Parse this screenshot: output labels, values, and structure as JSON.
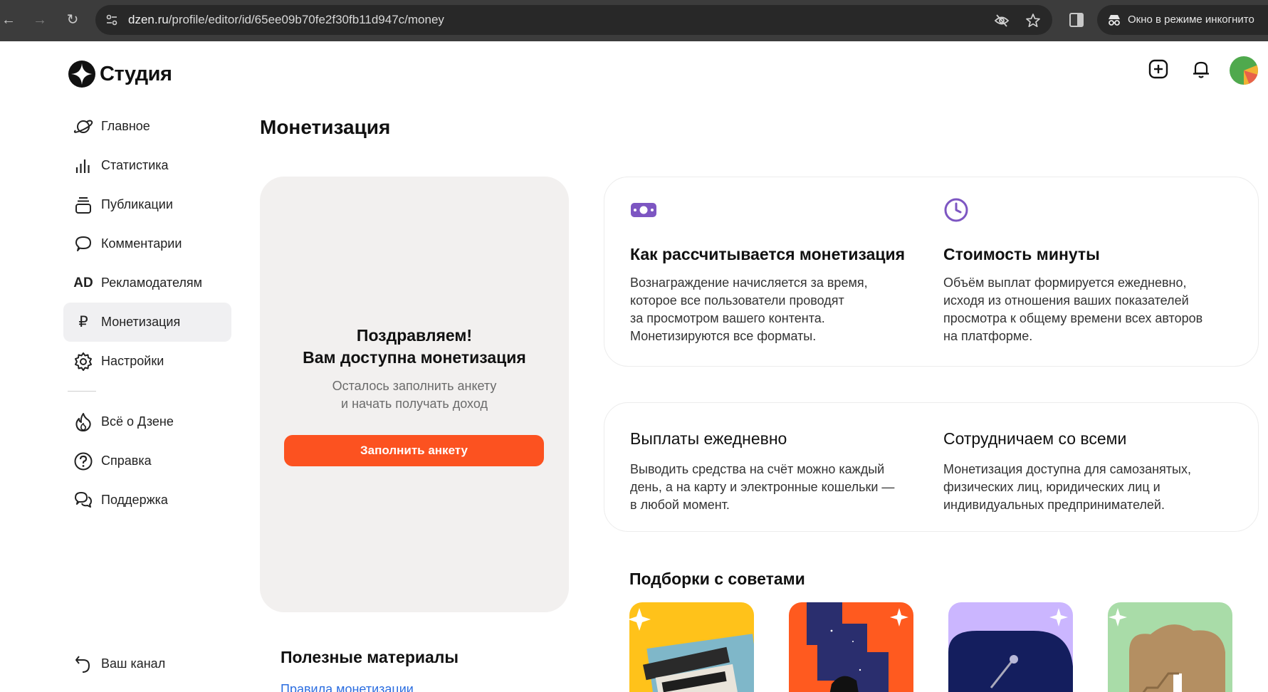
{
  "browser": {
    "url_host": "dzen.ru",
    "url_path": "/profile/editor/id/65ee09b70fe2f30fb11d947c/money",
    "incognito_label": "Окно в режиме инкогнито"
  },
  "header": {
    "logo_text": "Студия"
  },
  "sidebar": {
    "items": [
      {
        "label": "Главное",
        "icon": "planet-icon"
      },
      {
        "label": "Статистика",
        "icon": "bar-chart-icon"
      },
      {
        "label": "Публикации",
        "icon": "stack-icon"
      },
      {
        "label": "Комментарии",
        "icon": "comment-icon"
      },
      {
        "label": "Рекламодателям",
        "icon": "ad-icon",
        "icon_text": "AD"
      },
      {
        "label": "Монетизация",
        "icon": "ruble-icon",
        "icon_text": "₽",
        "active": true
      },
      {
        "label": "Настройки",
        "icon": "gear-icon"
      },
      {
        "label": "Всё о Дзене",
        "icon": "flame-icon"
      },
      {
        "label": "Справка",
        "icon": "help-icon"
      },
      {
        "label": "Поддержка",
        "icon": "support-chat-icon"
      },
      {
        "label": "Ваш канал",
        "icon": "back-arrow-icon"
      }
    ]
  },
  "main": {
    "title": "Монетизация",
    "promo": {
      "title_line1": "Поздравляем!",
      "title_line2": "Вам доступна монетизация",
      "sub_line1": "Осталось заполнить анкету",
      "sub_line2": "и начать получать доход",
      "button": "Заполнить анкету"
    },
    "info1": {
      "left": {
        "icon": "money-icon",
        "title": "Как рассчитывается монетизация",
        "lines": [
          "Вознаграждение начисляется за время,",
          "которое все пользователи проводят",
          "за просмотром вашего контента.",
          "Монетизируются все форматы."
        ]
      },
      "right": {
        "icon": "clock-icon",
        "title": "Стоимость минуты",
        "lines": [
          "Объём выплат формируется ежедневно,",
          "исходя из отношения ваших показателей",
          "просмотра к общему времени всех авторов",
          "на платформе."
        ]
      }
    },
    "info2": {
      "left": {
        "title": "Выплаты ежедневно",
        "lines": [
          "Выводить средства на счёт можно каждый",
          "день, а на карту и электронные кошельки —",
          "в любой момент."
        ]
      },
      "right": {
        "title": "Сотрудничаем со всеми",
        "lines": [
          "Монетизация доступна для самозанятых,",
          "физических лиц, юридических лиц и",
          "индивидуальных предпринимателей."
        ]
      }
    },
    "tips_title": "Подборки с советами",
    "tips_colors": [
      "#ffc21a",
      "#ff5a1f",
      "#cbb6ff",
      "#a9dca8"
    ],
    "useful_title": "Полезные материалы",
    "useful_link": "Правила монетизации"
  },
  "colors": {
    "accent": "#fc5220",
    "promo_bg": "#f2f0ef",
    "icon_purple": "#7d56c2"
  }
}
